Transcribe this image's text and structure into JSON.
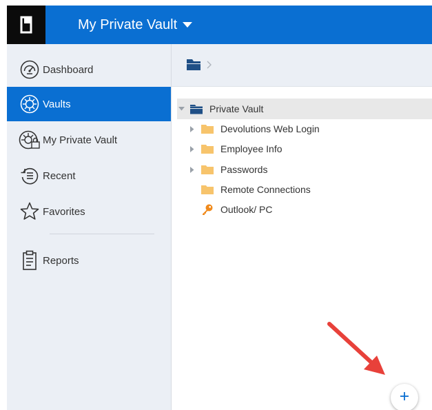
{
  "header": {
    "vault_name": "My Private Vault",
    "accent_color": "#0a6fd2",
    "logo_icon": "device-icon",
    "dropdown_icon": "caret-down-icon"
  },
  "sidebar": {
    "items": [
      {
        "label": "Dashboard",
        "icon": "speedometer-icon",
        "active": false
      },
      {
        "label": "Vaults",
        "icon": "vault-dial-icon",
        "active": true
      },
      {
        "label": "My Private Vault",
        "icon": "private-vault-icon",
        "active": false
      },
      {
        "label": "Recent",
        "icon": "history-icon",
        "active": false
      },
      {
        "label": "Favorites",
        "icon": "star-icon",
        "active": false
      },
      {
        "label": "Reports",
        "icon": "clipboard-icon",
        "active": false
      }
    ]
  },
  "breadcrumb": {
    "root_icon": "folder-stack-icon",
    "separator_icon": "chevron-right-icon"
  },
  "tree": {
    "root": {
      "label": "Private Vault",
      "icon": "folder-stack-icon",
      "expanded": true
    },
    "children": [
      {
        "label": "Devolutions Web Login",
        "icon": "folder-icon",
        "has_children": true
      },
      {
        "label": "Employee Info",
        "icon": "folder-icon",
        "has_children": true
      },
      {
        "label": "Passwords",
        "icon": "folder-icon",
        "has_children": true
      },
      {
        "label": "Remote Connections",
        "icon": "folder-icon",
        "has_children": false
      },
      {
        "label": "Outlook/ PC",
        "icon": "key-icon",
        "has_children": false
      }
    ]
  },
  "fab": {
    "icon": "plus-icon",
    "color": "#0a6fd2"
  },
  "annotation": {
    "icon": "red-arrow-icon",
    "color": "#e8413a"
  }
}
